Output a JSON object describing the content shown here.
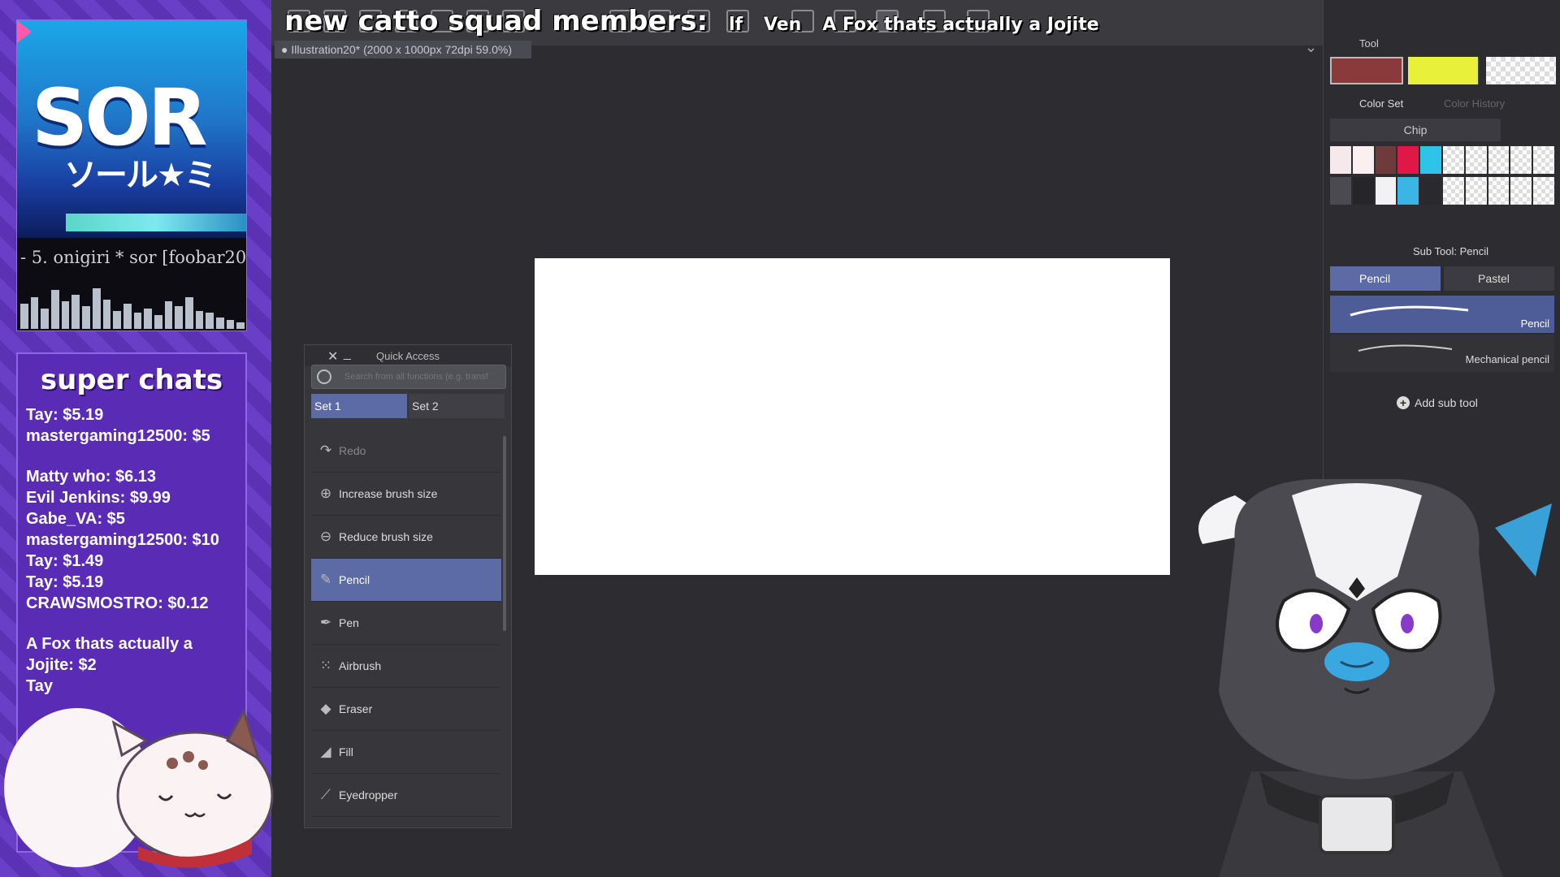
{
  "stream": {
    "album": {
      "logo": "SOR",
      "logo_sub": "ソール★ミ",
      "now_playing": "- 5. onigiri * sor [foobar20"
    },
    "visualizer_levels": [
      0.55,
      0.7,
      0.45,
      0.85,
      0.6,
      0.75,
      0.5,
      0.9,
      0.65,
      0.4,
      0.55,
      0.35,
      0.45,
      0.3,
      0.6,
      0.5,
      0.7,
      0.4,
      0.35,
      0.25,
      0.2,
      0.15
    ],
    "overlay_title": "new catto squad members:",
    "overlay_names": [
      "lf",
      "Ven",
      "A Fox thats actually a Jojite"
    ],
    "super_chats_title": "super chats",
    "super_chats": [
      "Tay: $5.19",
      "mastergaming12500: $5",
      "",
      "Matty who: $6.13",
      "Evil Jenkins: $9.99",
      "Gabe_VA: $5",
      "mastergaming12500: $10",
      "Tay: $1.49",
      "Tay: $5.19",
      "CRAWSMOSTRO: $0.12",
      "",
      "A Fox thats actually a Jojite: $2",
      "Tay"
    ]
  },
  "app": {
    "document_tab": "Illustration20* (2000 x 1000px 72dpi 59.0%)"
  },
  "quick_access": {
    "title": "Quick Access",
    "search_placeholder": "Search from all functions (e.g. transf",
    "tabs": [
      "Set 1",
      "Set 2"
    ],
    "items": [
      {
        "label": "Redo",
        "icon": "redo-icon",
        "dim": true
      },
      {
        "label": "Increase brush size",
        "icon": "brush-size-increase-icon"
      },
      {
        "label": "Reduce brush size",
        "icon": "brush-size-reduce-icon"
      },
      {
        "label": "Pencil",
        "icon": "pencil-icon",
        "selected": true
      },
      {
        "label": "Pen",
        "icon": "pen-icon"
      },
      {
        "label": "Airbrush",
        "icon": "airbrush-icon"
      },
      {
        "label": "Eraser",
        "icon": "eraser-icon"
      },
      {
        "label": "Fill",
        "icon": "fill-icon"
      },
      {
        "label": "Eyedropper",
        "icon": "eyedropper-icon"
      }
    ]
  },
  "right_panel": {
    "tool_header": "Tool",
    "colors": {
      "main": "#8b3a3b",
      "sub": "#e8f03a"
    },
    "color_set_tab": "Color Set",
    "color_history_tab": "Color History",
    "chip_select": "Chip",
    "chip_colors": [
      "#f6e9ec",
      "#fbeff1",
      "#6e3a3b",
      "#e01848",
      "#2ec4e8",
      "#transparent",
      "#transparent",
      "#transparent",
      "#transparent",
      "#transparent",
      "#4a4a50",
      "#26262a",
      "#f2f2f4",
      "#3bb4e6",
      "#2a2a2e",
      "#transparent",
      "#transparent",
      "#transparent",
      "#transparent",
      "#transparent"
    ],
    "sub_tool_header": "Sub Tool: Pencil",
    "sub_tool_tabs": [
      "Pencil",
      "Pastel"
    ],
    "brushes": [
      "Pencil",
      "Mechanical pencil"
    ],
    "add_sub_tool": "Add sub tool"
  }
}
